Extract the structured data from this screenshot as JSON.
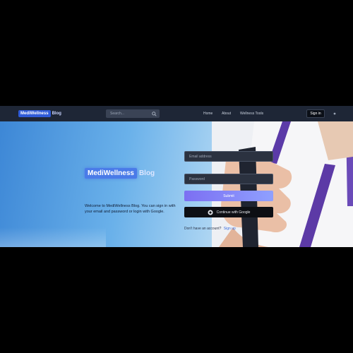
{
  "navbar": {
    "brand": "MediWellness",
    "brand_suffix": "Blog",
    "search_placeholder": "Search...",
    "links": [
      "Home",
      "About",
      "Wellness Tools"
    ],
    "signin_label": "Sign in"
  },
  "hero": {
    "title": "MediWellness",
    "title_suffix": "Blog",
    "description": "Welcome to MediWellness Blog. You can sign in with your email and password or login with Google."
  },
  "login_form": {
    "email_placeholder": "Email address",
    "password_placeholder": "Password",
    "submit_label": "Submit",
    "google_label": "Continue with Google",
    "signup_prompt": "Don't have an account?",
    "signup_link": "Sign up"
  },
  "colors": {
    "navbar_bg": "#1e2636",
    "accent": "#4a7be8",
    "submit_gradient": [
      "#7c6ff2",
      "#8fa0ff"
    ]
  },
  "icons": [
    "search-icon",
    "google-icon",
    "menu-icon"
  ]
}
